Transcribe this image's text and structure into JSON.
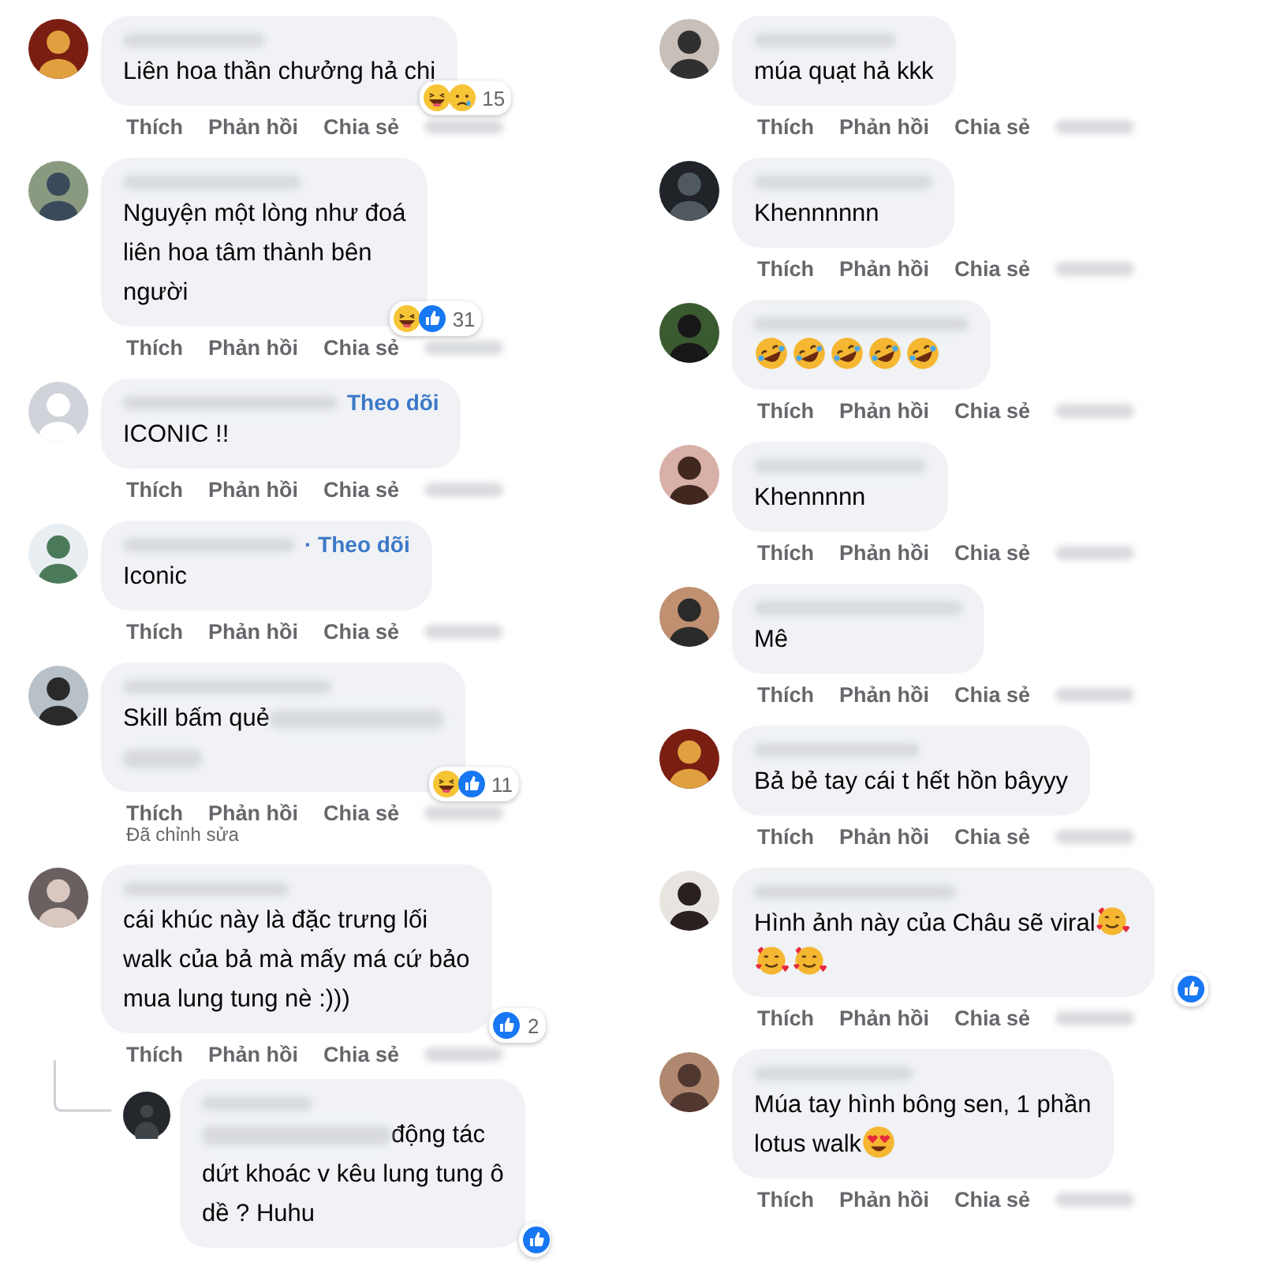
{
  "columns": [
    {
      "comments": [
        {
          "lines": [
            {
              "text": "Liên hoa thần chưởng hả chị"
            }
          ],
          "reactions": [
            {
              "kind": "haha"
            },
            {
              "kind": "sad"
            }
          ],
          "reaction_count": "15",
          "actions": [
            "Thích",
            "Phản hồi",
            "Chia sẻ"
          ]
        },
        {
          "lines": [
            {
              "text": "Nguyện một lòng như đoá"
            },
            {
              "text": "liên hoa tâm thành bên"
            },
            {
              "text": "người"
            }
          ],
          "reactions": [
            {
              "kind": "haha"
            },
            {
              "kind": "like"
            }
          ],
          "reaction_count": "31",
          "actions": [
            "Thích",
            "Phản hồi",
            "Chia sẻ"
          ]
        },
        {
          "follow": "Theo dõi",
          "lines": [
            {
              "text": "ICONIC !!"
            }
          ],
          "actions": [
            "Thích",
            "Phản hồi",
            "Chia sẻ"
          ]
        },
        {
          "follow": "· Theo dõi",
          "lines": [
            {
              "text": "Iconic"
            }
          ],
          "actions": [
            "Thích",
            "Phản hồi",
            "Chia sẻ"
          ]
        },
        {
          "lines": [
            {
              "text": "Skill bấm quẻ",
              "blurred_tail": true
            }
          ],
          "blurred_tail": true,
          "reactions": [
            {
              "kind": "haha"
            },
            {
              "kind": "like"
            }
          ],
          "reaction_count": "11",
          "actions": [
            "Thích",
            "Phản hồi",
            "Chia sẻ"
          ],
          "edited": "Đã chỉnh sửa"
        },
        {
          "lines": [
            {
              "text": "cái khúc này là đặc trưng lối"
            },
            {
              "text": "walk của bả mà mấy má cứ bảo"
            },
            {
              "text": "mua lung tung nè :)))"
            }
          ],
          "reactions": [
            {
              "kind": "like"
            }
          ],
          "reaction_count": "2",
          "actions": [
            "Thích",
            "Phản hồi",
            "Chia sẻ"
          ],
          "replies": [
            {
              "lines": [
                {
                  "text": "động tác",
                  "blurred_lead": true
                },
                {
                  "text": "dứt khoác v kêu lung tung ô"
                },
                {
                  "text": "dề ? Huhu"
                }
              ],
              "reactions": [
                {
                  "kind": "like"
                }
              ]
            }
          ]
        }
      ]
    },
    {
      "comments": [
        {
          "lines": [
            {
              "text": "múa quạt hả kkk"
            }
          ],
          "actions": [
            "Thích",
            "Phản hồi",
            "Chia sẻ"
          ]
        },
        {
          "lines": [
            {
              "text": "Khennnnnn"
            }
          ],
          "actions": [
            "Thích",
            "Phản hồi",
            "Chia sẻ"
          ]
        },
        {
          "lines": [
            {
              "emojis": [
                {
                  "kind": "rolling"
                },
                {
                  "kind": "rolling"
                },
                {
                  "kind": "rolling"
                },
                {
                  "kind": "rolling"
                },
                {
                  "kind": "rolling"
                }
              ]
            }
          ],
          "actions": [
            "Thích",
            "Phản hồi",
            "Chia sẻ"
          ]
        },
        {
          "lines": [
            {
              "text": "Khennnnn"
            }
          ],
          "actions": [
            "Thích",
            "Phản hồi",
            "Chia sẻ"
          ]
        },
        {
          "lines": [
            {
              "text": "Mê"
            }
          ],
          "actions": [
            "Thích",
            "Phản hồi",
            "Chia sẻ"
          ]
        },
        {
          "lines": [
            {
              "text": "Bả bẻ tay cái t hết hồn bâyyy"
            }
          ],
          "actions": [
            "Thích",
            "Phản hồi",
            "Chia sẻ"
          ]
        },
        {
          "lines": [
            {
              "text": "Hình ảnh này của Châu sẽ viral",
              "emojis": [
                {
                  "kind": "hearts"
                }
              ]
            },
            {
              "emojis": [
                {
                  "kind": "hearts"
                },
                {
                  "kind": "hearts"
                }
              ]
            }
          ],
          "reactions": [
            {
              "kind": "like"
            }
          ],
          "actions": [
            "Thích",
            "Phản hồi",
            "Chia sẻ"
          ]
        },
        {
          "lines": [
            {
              "text": "Múa tay hình bông sen, 1 phần"
            },
            {
              "text": "lotus walk",
              "emojis": [
                {
                  "kind": "heart-eyes"
                }
              ]
            }
          ],
          "actions": [
            "Thích",
            "Phản hồi",
            "Chia sẻ"
          ]
        }
      ]
    }
  ]
}
